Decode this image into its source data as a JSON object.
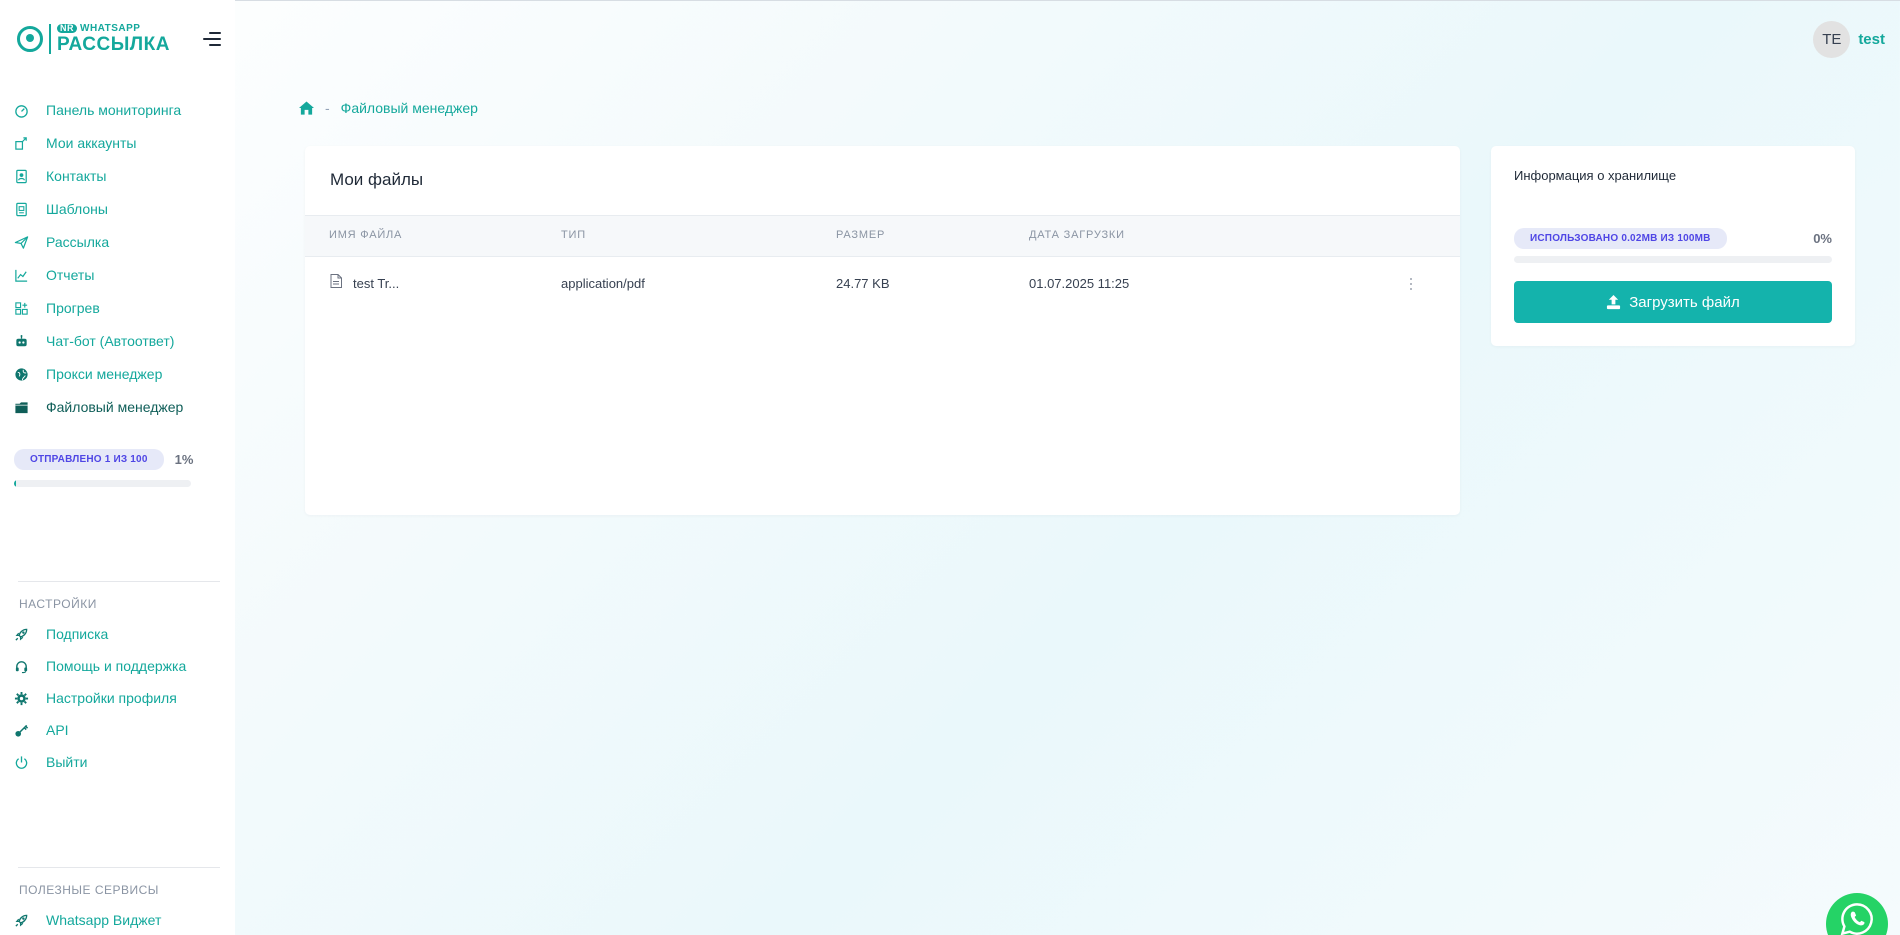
{
  "app": {
    "logo_top": "WHATSAPP",
    "logo_badge": "NR",
    "logo_bottom": "РАССЫЛКА"
  },
  "header": {
    "avatar_initials": "TE",
    "username": "test"
  },
  "sidebar": {
    "items": [
      {
        "label": "Панель мониторинга",
        "icon": "dashboard-icon"
      },
      {
        "label": "Мои аккаунты",
        "icon": "accounts-icon"
      },
      {
        "label": "Контакты",
        "icon": "contacts-icon"
      },
      {
        "label": "Шаблоны",
        "icon": "templates-icon"
      },
      {
        "label": "Рассылка",
        "icon": "send-icon"
      },
      {
        "label": "Отчеты",
        "icon": "reports-icon"
      },
      {
        "label": "Прогрев",
        "icon": "warmup-icon"
      },
      {
        "label": "Чат-бот (Автоответ)",
        "icon": "robot-icon"
      },
      {
        "label": "Прокси менеджер",
        "icon": "globe-icon"
      },
      {
        "label": "Файловый менеджер",
        "icon": "folder-icon"
      }
    ],
    "sent": {
      "label": "ОТПРАВЛЕНО 1 ИЗ 100",
      "percent_text": "1%",
      "progress": 0.01
    },
    "settings_title": "НАСТРОЙКИ",
    "settings_items": [
      {
        "label": "Подписка",
        "icon": "rocket-icon"
      },
      {
        "label": "Помощь и поддержка",
        "icon": "headset-icon"
      },
      {
        "label": "Настройки профиля",
        "icon": "gear-icon"
      },
      {
        "label": "API",
        "icon": "key-icon"
      },
      {
        "label": "Выйти",
        "icon": "power-icon"
      }
    ],
    "services_title": "ПОЛЕЗНЫЕ СЕРВИСЫ",
    "services_items": [
      {
        "label": "Whatsapp Виджет",
        "icon": "rocket-icon"
      }
    ]
  },
  "breadcrumb": {
    "current": "Файловый менеджер",
    "separator": "-"
  },
  "files": {
    "title": "Мои файлы",
    "columns": [
      "ИМЯ ФАЙЛА",
      "ТИП",
      "РАЗМЕР",
      "ДАТА ЗАГРУЗКИ"
    ],
    "rows": [
      {
        "name": "test Tr...",
        "type": "application/pdf",
        "size": "24.77 KB",
        "date": "01.07.2025 11:25"
      }
    ]
  },
  "storage": {
    "title": "Информация о хранилище",
    "used_label": "ИСПОЛЬЗОВАНО 0.02MB ИЗ 100MB",
    "percent_text": "0%",
    "progress": 0.0002,
    "upload_label": "Загрузить файл"
  },
  "colors": {
    "accent": "#14a89c",
    "button": "#14b3ac",
    "pill_bg": "#e6e9f8",
    "pill_text": "#4f46e5",
    "whatsapp": "#25d366"
  }
}
